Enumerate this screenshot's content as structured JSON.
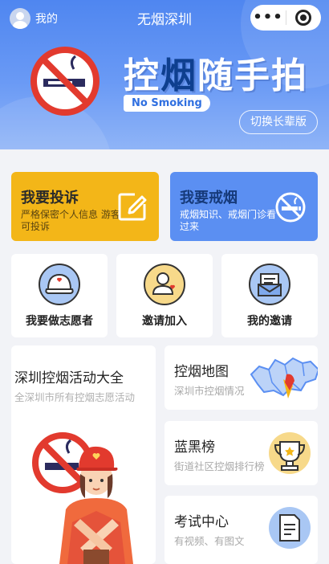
{
  "header": {
    "me_label": "我的",
    "app_title": "无烟深圳",
    "capsule_more": "•••"
  },
  "hero": {
    "title_part1": "控",
    "title_em": "烟",
    "title_part2": "随手拍",
    "tag": "No Smoking",
    "switch_label": "切换长辈版"
  },
  "actions": {
    "complaint": {
      "title": "我要投诉",
      "sub": "严格保密个人信息 游客可投诉"
    },
    "quit": {
      "title": "我要戒烟",
      "sub": "戒烟知识、戒烟门诊看过来"
    }
  },
  "shortcuts": [
    {
      "label": "我要做志愿者",
      "icon": "volunteer-cap-icon"
    },
    {
      "label": "邀请加入",
      "icon": "invite-user-icon"
    },
    {
      "label": "我的邀请",
      "icon": "my-invitation-icon"
    }
  ],
  "activity": {
    "title": "深圳控烟活动大全",
    "sub": "全深圳市所有控烟志愿活动"
  },
  "side_cards": [
    {
      "title": "控烟地图",
      "sub": "深圳市控烟情况",
      "icon": "map-icon"
    },
    {
      "title": "蓝黑榜",
      "sub": "街道社区控烟排行榜",
      "icon": "trophy-icon"
    },
    {
      "title": "考试中心",
      "sub": "有视频、有图文",
      "icon": "exam-icon"
    }
  ],
  "colors": {
    "hero_blue": "#4f86f0",
    "complaint_yellow": "#f3b618",
    "quit_blue": "#5b8ff2",
    "no_smoking_red": "#e23a2e",
    "page_bg": "#f2f3f7"
  }
}
